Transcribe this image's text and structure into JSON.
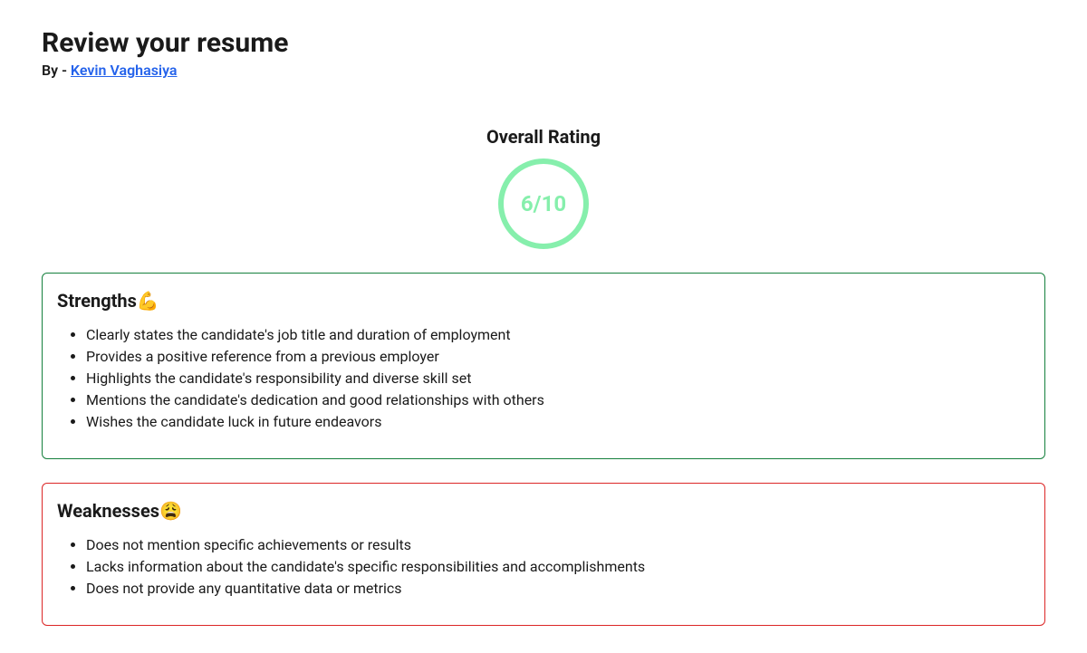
{
  "header": {
    "title": "Review your resume",
    "byline_prefix": "By - ",
    "author": "Kevin Vaghasiya"
  },
  "rating": {
    "label": "Overall Rating",
    "value": "6/10"
  },
  "strengths": {
    "title": "Strengths💪",
    "items": [
      "Clearly states the candidate's job title and duration of employment",
      "Provides a positive reference from a previous employer",
      "Highlights the candidate's responsibility and diverse skill set",
      "Mentions the candidate's dedication and good relationships with others",
      "Wishes the candidate luck in future endeavors"
    ]
  },
  "weaknesses": {
    "title": "Weaknesses😩",
    "items": [
      "Does not mention specific achievements or results",
      "Lacks information about the candidate's specific responsibilities and accomplishments",
      "Does not provide any quantitative data or metrics"
    ]
  }
}
